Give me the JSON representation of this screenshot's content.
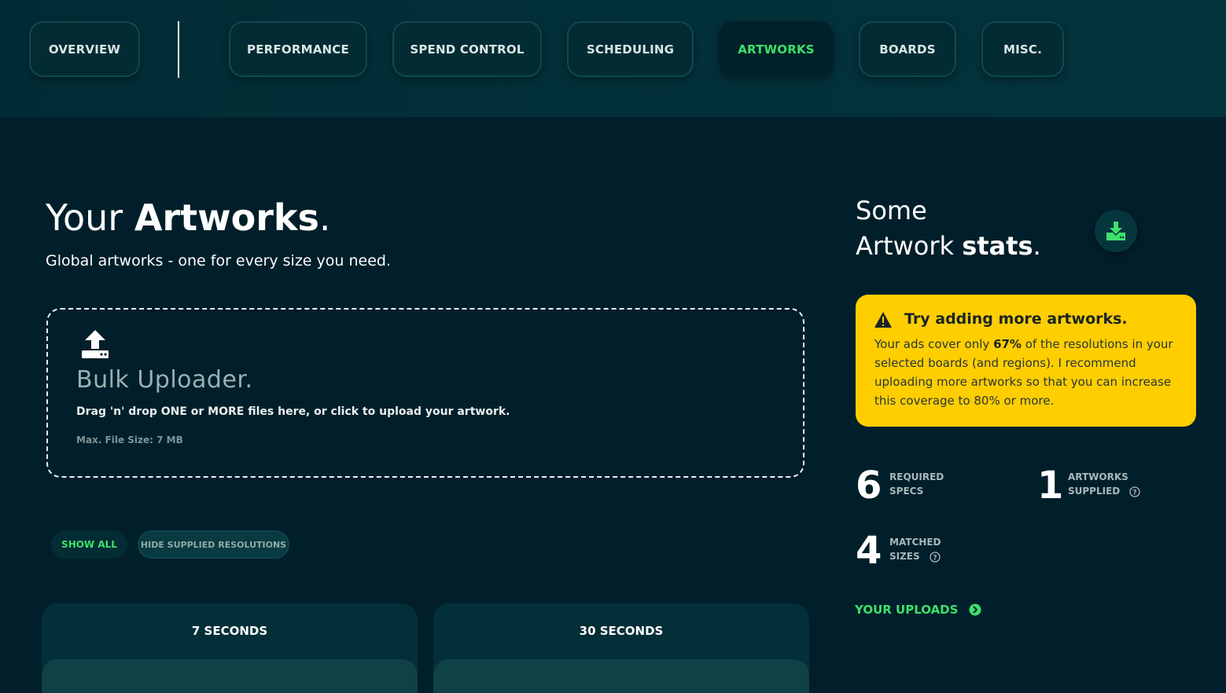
{
  "nav": {
    "tabs": [
      {
        "label": "OVERVIEW"
      },
      {
        "label": "PERFORMANCE"
      },
      {
        "label": "SPEND CONTROL"
      },
      {
        "label": "SCHEDULING"
      },
      {
        "label": "ARTWORKS",
        "active": true
      },
      {
        "label": "BOARDS"
      },
      {
        "label": "MISC."
      }
    ]
  },
  "main": {
    "title_prefix": "Your ",
    "title_bold": "Artworks",
    "title_suffix": ".",
    "subtitle": "Global artworks - one for every size you need.",
    "uploader": {
      "title": "Bulk Uploader.",
      "instructions": "Drag 'n' drop ONE or MORE files here, or click to upload your artwork.",
      "max_size": "Max. File Size: 7 MB",
      "icon": "upload-icon"
    },
    "filters": {
      "show_all": "SHOW ALL",
      "hide_supplied": "HIDE SUPPLIED RESOLUTIONS"
    },
    "cards": [
      {
        "title": "7 SECONDS"
      },
      {
        "title": "30 SECONDS"
      }
    ]
  },
  "stats": {
    "title_line1": "Some",
    "title_line2_prefix": "Artwork ",
    "title_line2_bold": "stats",
    "title_line2_suffix": ".",
    "download_icon": "download-icon",
    "alert": {
      "title": "Try adding more artworks.",
      "body_prefix": "Your ads cover only ",
      "body_percent": "67%",
      "body_suffix": " of the resolutions in your selected boards (and regions). I recommend uploading more artworks so that you can increase this coverage to 80% or more."
    },
    "required_specs": {
      "value": "6",
      "label1": "REQUIRED",
      "label2": "SPECS"
    },
    "artworks_supplied": {
      "value": "1",
      "label1": "ARTWORKS",
      "label2": "SUPPLIED"
    },
    "matched_sizes": {
      "value": "4",
      "label1": "MATCHED",
      "label2": "SIZES"
    },
    "uploads_link": "YOUR UPLOADS"
  },
  "colors": {
    "background": "#011f2a",
    "accent": "#3ee06a",
    "alert": "#ffce00"
  }
}
